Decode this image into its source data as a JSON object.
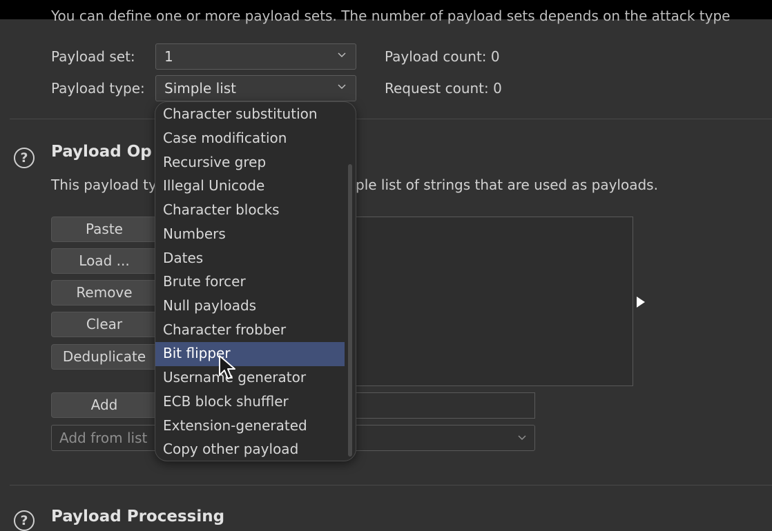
{
  "header_text": "You can define one or more payload sets. The number of payload sets depends on the attack type",
  "payload_set": {
    "label": "Payload set:",
    "value": "1"
  },
  "payload_type": {
    "label": "Payload type:",
    "value": "Simple list"
  },
  "payload_count": "Payload count: 0",
  "request_count": "Request count: 0",
  "options_section": {
    "title": "Payload Op",
    "description_left": "This payload ty",
    "description_right": "ple list of strings that are used as payloads."
  },
  "buttons": {
    "paste": "Paste",
    "load": "Load ...",
    "remove": "Remove",
    "clear": "Clear",
    "deduplicate": "Deduplicate",
    "add": "Add"
  },
  "add_from_list_placeholder": "Add from list",
  "dropdown": {
    "items": [
      "Character substitution",
      "Case modification",
      "Recursive grep",
      "Illegal Unicode",
      "Character blocks",
      "Numbers",
      "Dates",
      "Brute forcer",
      "Null payloads",
      "Character frobber",
      "Bit flipper",
      "Username generator",
      "ECB block shuffler",
      "Extension-generated",
      "Copy other payload"
    ],
    "selected": "Bit flipper"
  },
  "processing_section": {
    "title": "Payload Processing"
  },
  "icons": {
    "help": "help-circle-icon",
    "chevron": "chevron-down-icon",
    "expand": "expand-arrow-icon",
    "cursor": "mouse-pointer-icon"
  },
  "colors": {
    "background": "#323232",
    "selection": "#415078",
    "dropdown_bg": "#2b2b2b"
  }
}
